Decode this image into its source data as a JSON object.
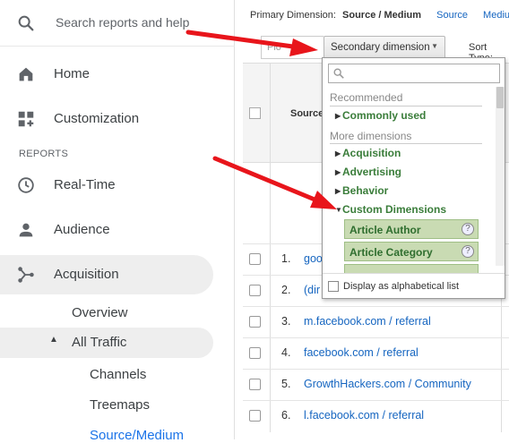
{
  "sidebar": {
    "search_placeholder": "Search reports and help",
    "home_label": "Home",
    "customization_label": "Customization",
    "section_reports": "REPORTS",
    "realtime_label": "Real-Time",
    "audience_label": "Audience",
    "acquisition_label": "Acquisition",
    "overview_label": "Overview",
    "all_traffic_label": "All Traffic",
    "channels_label": "Channels",
    "treemaps_label": "Treemaps",
    "source_medium_label": "Source/Medium"
  },
  "main": {
    "primary_dimension_label": "Primary Dimension:",
    "primary_dimension_active": "Source / Medium",
    "primary_dimension_links": [
      "Source",
      "Medium"
    ],
    "filter_stub": "Plo",
    "secondary_button": "Secondary dimension",
    "sort_type_label": "Sort Type:",
    "table_header": "Source",
    "rows": [
      {
        "num": "1.",
        "source": "goo"
      },
      {
        "num": "2.",
        "source": "(dir"
      },
      {
        "num": "3.",
        "source": "m.facebook.com / referral"
      },
      {
        "num": "4.",
        "source": "facebook.com / referral"
      },
      {
        "num": "5.",
        "source": "GrowthHackers.com / Community"
      },
      {
        "num": "6.",
        "source": "l.facebook.com / referral"
      }
    ]
  },
  "dropdown": {
    "recommended_heading": "Recommended",
    "commonly_used": "Commonly used",
    "more_heading": "More dimensions",
    "acquisition": "Acquisition",
    "advertising": "Advertising",
    "behavior": "Behavior",
    "custom_dimensions": "Custom Dimensions",
    "options": [
      "Article Author",
      "Article Category"
    ],
    "help_glyph": "?",
    "alphabetical_label": "Display as alphabetical list"
  },
  "colors": {
    "link": "#1565c0",
    "arrow": "#e8151b",
    "option_bg": "#c9dbb3",
    "active_nav": "#eeeeee"
  }
}
